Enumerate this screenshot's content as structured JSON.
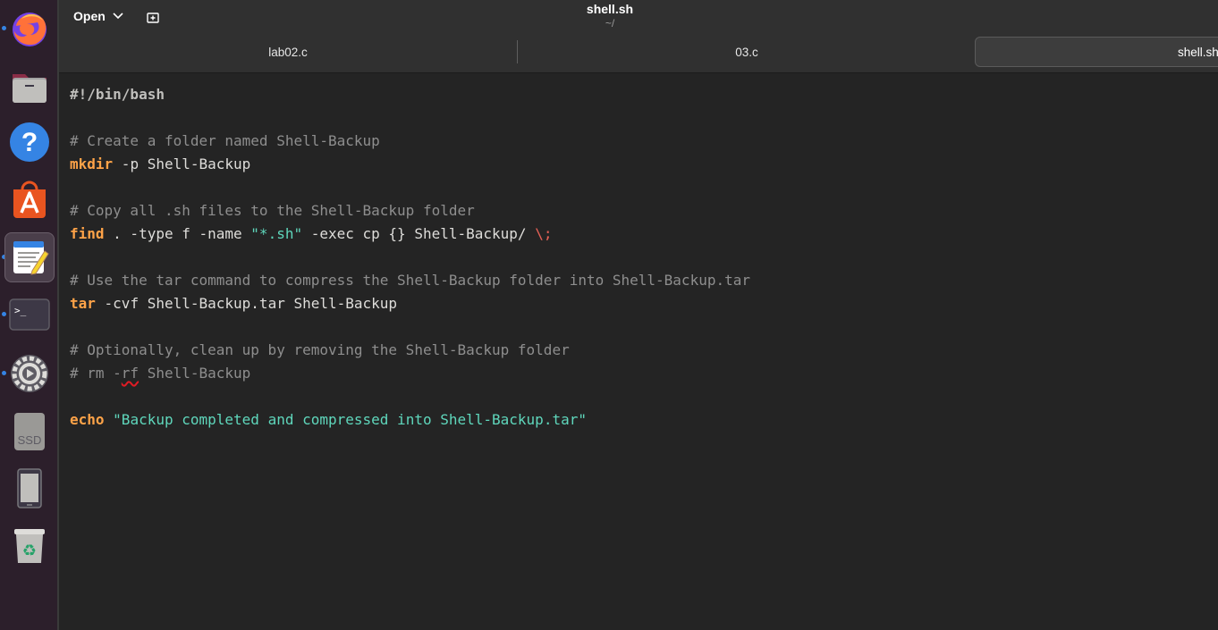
{
  "dock": {
    "items": [
      {
        "name": "firefox-icon",
        "label": "Firefox"
      },
      {
        "name": "files-icon",
        "label": "Files"
      },
      {
        "name": "help-icon",
        "label": "Help"
      },
      {
        "name": "app-center-icon",
        "label": "App Center"
      },
      {
        "name": "text-editor-icon",
        "label": "Text Editor"
      },
      {
        "name": "terminal-icon",
        "label": "Terminal"
      },
      {
        "name": "settings-icon",
        "label": "Settings"
      },
      {
        "name": "ssd-drive-icon",
        "label": "SSD"
      },
      {
        "name": "removable-device-icon",
        "label": "Device"
      },
      {
        "name": "trash-icon",
        "label": "Trash"
      }
    ],
    "ssd_label": "SSD",
    "accent": "#3584e4"
  },
  "header": {
    "open_label": "Open",
    "title": "shell.sh",
    "subtitle": "~/"
  },
  "tabs": [
    {
      "label": "lab02.c"
    },
    {
      "label": "03.c"
    },
    {
      "label": "shell.sh"
    }
  ],
  "editor": {
    "lines": [
      {
        "type": "shebang",
        "parts": [
          "#!/bin/bash"
        ]
      },
      {
        "type": "blank",
        "parts": []
      },
      {
        "type": "comment",
        "parts": [
          "# Create a folder named Shell-Backup"
        ]
      },
      {
        "type": "code",
        "kw": "mkdir",
        "rest": " -p Shell-Backup"
      },
      {
        "type": "blank",
        "parts": []
      },
      {
        "type": "comment",
        "parts": [
          "# Copy all .sh files to the Shell-Backup folder"
        ]
      },
      {
        "type": "code",
        "kw": "find",
        "rest": " . -type f -name ",
        "str": "\"*.sh\"",
        "rest2": " -exec cp {} Shell-Backup/ ",
        "esc": "\\;"
      },
      {
        "type": "blank",
        "parts": []
      },
      {
        "type": "comment",
        "parts": [
          "# Use the tar command to compress the Shell-Backup folder into Shell-Backup.tar"
        ]
      },
      {
        "type": "code",
        "kw": "tar",
        "rest": " -cvf Shell-Backup.tar Shell-Backup"
      },
      {
        "type": "blank",
        "parts": []
      },
      {
        "type": "comment",
        "parts": [
          "# Optionally, clean up by removing the Shell-Backup folder"
        ]
      },
      {
        "type": "comment-squiggle",
        "pre": "# rm -",
        "sq": "rf",
        "post": " Shell-Backup"
      },
      {
        "type": "blank",
        "parts": []
      },
      {
        "type": "code",
        "kw": "echo",
        "rest": " ",
        "str": "\"Backup completed and compressed into Shell-Backup.tar\""
      }
    ],
    "colors": {
      "background": "#242424",
      "keyword": "#ffa348",
      "string": "#5fd7bc",
      "comment": "#8e8e8e",
      "escape": "#e66156"
    }
  }
}
